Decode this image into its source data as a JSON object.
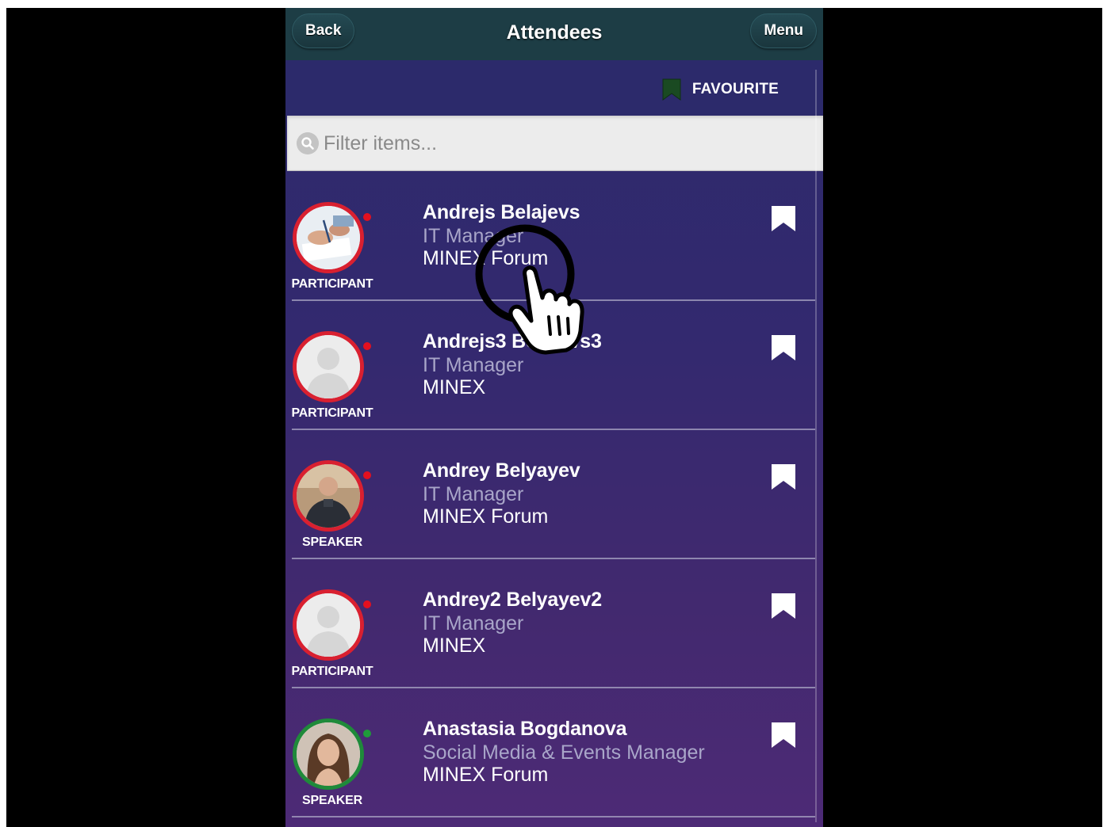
{
  "header": {
    "back_label": "Back",
    "title": "Attendees",
    "menu_label": "Menu"
  },
  "favourite": {
    "label": "FAVOURITE"
  },
  "search": {
    "placeholder": "Filter items...",
    "value": ""
  },
  "attendees": [
    {
      "name": "Andrejs Belajevs",
      "title": "IT Manager",
      "company": "MINEX Forum",
      "role": "PARTICIPANT",
      "status": "red",
      "avatar": "photo-documents"
    },
    {
      "name": "Andrejs3 Belajevs3",
      "title": "IT Manager",
      "company": "MINEX",
      "role": "PARTICIPANT",
      "status": "red",
      "avatar": "placeholder"
    },
    {
      "name": "Andrey Belyayev",
      "title": "IT Manager",
      "company": "MINEX Forum",
      "role": "SPEAKER",
      "status": "red",
      "avatar": "photo-man"
    },
    {
      "name": "Andrey2 Belyayev2",
      "title": "IT Manager",
      "company": "MINEX",
      "role": "PARTICIPANT",
      "status": "red",
      "avatar": "placeholder"
    },
    {
      "name": "Anastasia Bogdanova",
      "title": "Social Media & Events Manager",
      "company": "MINEX Forum",
      "role": "SPEAKER",
      "status": "green",
      "avatar": "photo-woman"
    }
  ],
  "colors": {
    "header_bg": "#1d3d45",
    "list_bg_top": "#2c2a6b",
    "list_bg_bottom": "#4d2a76",
    "status_red": "#e3101f",
    "status_green": "#1f9a3a",
    "favourite_icon": "#1a4a22"
  },
  "icons": {
    "search": "search-icon",
    "bookmark": "bookmark-icon",
    "cursor": "hand-pointer-icon"
  }
}
